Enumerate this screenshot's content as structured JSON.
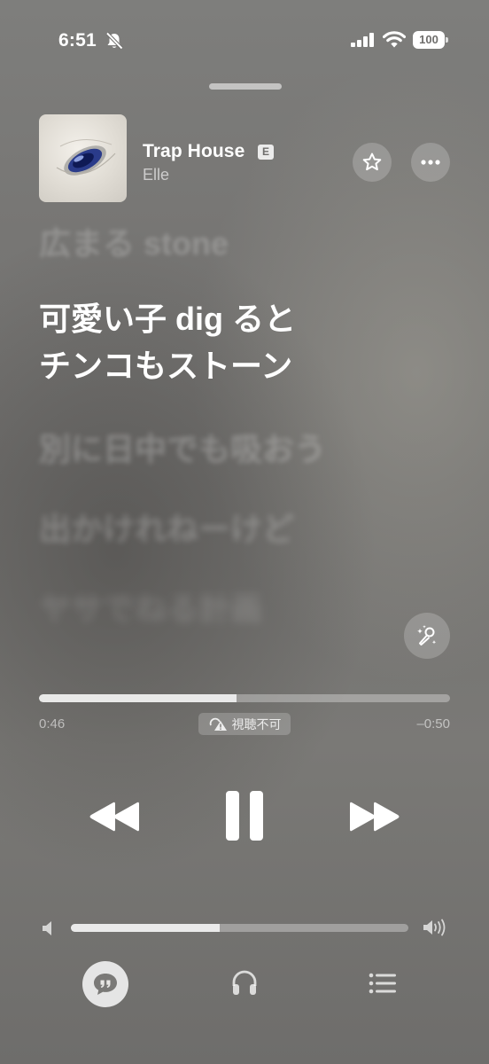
{
  "status_bar": {
    "time": "6:51",
    "battery": "100",
    "icons": [
      "bell-slash-icon",
      "cellular-signal-icon",
      "wifi-icon",
      "battery-icon"
    ]
  },
  "track": {
    "title": "Trap House",
    "explicit_badge": "E",
    "artist": "Elle"
  },
  "lyrics": {
    "previous": "広まる stone",
    "current_line1": "可愛い子 dig ると",
    "current_line2": "チンコもストーン",
    "next": [
      "別に日中でも吸おう",
      "出かけれねーけど",
      "ヤサでねる計画"
    ]
  },
  "playback": {
    "elapsed": "0:46",
    "remaining": "–0:50",
    "progress_fraction": 0.48,
    "unavailable_badge": "視聴不可"
  },
  "volume": {
    "level_fraction": 0.44
  },
  "colors": {
    "background": "#777674",
    "primary_text": "#ffffff",
    "secondary_text": "#c4c3c1"
  },
  "icons": {
    "favorite": "star-icon",
    "more": "ellipsis-icon",
    "sing": "microphone-sparkle-icon",
    "rewind": "rewind-icon",
    "pause": "pause-icon",
    "forward": "fast-forward-icon",
    "volume_low": "speaker-low-icon",
    "volume_high": "speaker-high-icon",
    "lyrics": "lyrics-quote-icon",
    "airplay": "headphones-icon",
    "queue": "queue-list-icon"
  }
}
